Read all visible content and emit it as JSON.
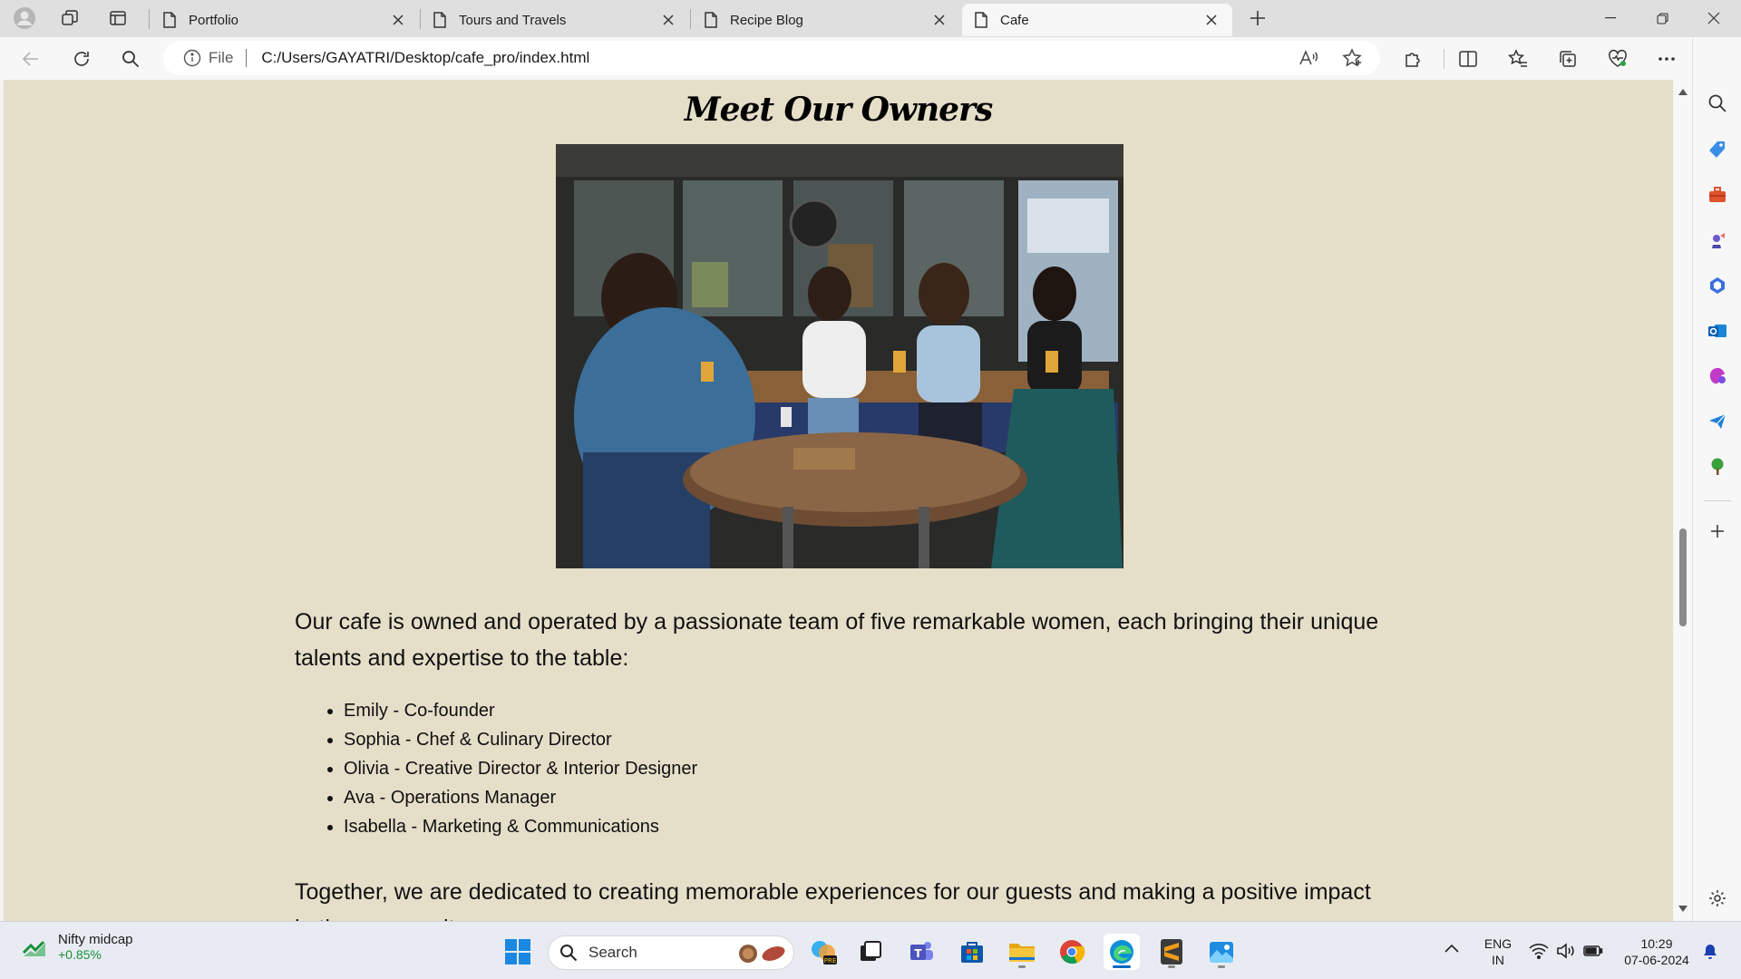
{
  "tabs": [
    {
      "title": "Portfolio",
      "active": false
    },
    {
      "title": "Tours and Travels",
      "active": false
    },
    {
      "title": "Recipe Blog",
      "active": false
    },
    {
      "title": "Cafe",
      "active": true
    }
  ],
  "address_bar": {
    "scheme_label": "File",
    "url": "C:/Users/GAYATRI/Desktop/cafe_pro/index.html"
  },
  "page": {
    "heading": "Meet Our Owners",
    "photo_alt": "Four women laughing at a cafe table",
    "intro": "Our cafe is owned and operated by a passionate team of five remarkable women, each bringing their unique talents and expertise to the table:",
    "owners": [
      "Emily - Co-founder",
      "Sophia - Chef & Culinary Director",
      "Olivia - Creative Director & Interior Designer",
      "Ava - Operations Manager",
      "Isabella - Marketing & Communications"
    ],
    "outro": "Together, we are dedicated to creating memorable experiences for our guests and making a positive impact in the community."
  },
  "taskbar": {
    "ticker_name": "Nifty midcap",
    "ticker_value": "+0.85%",
    "search_label": "Search",
    "language_line1": "ENG",
    "language_line2": "IN",
    "time": "10:29",
    "date": "07-06-2024"
  },
  "colors": {
    "page_background": "#e5dec9",
    "accent": "#0067c0"
  }
}
